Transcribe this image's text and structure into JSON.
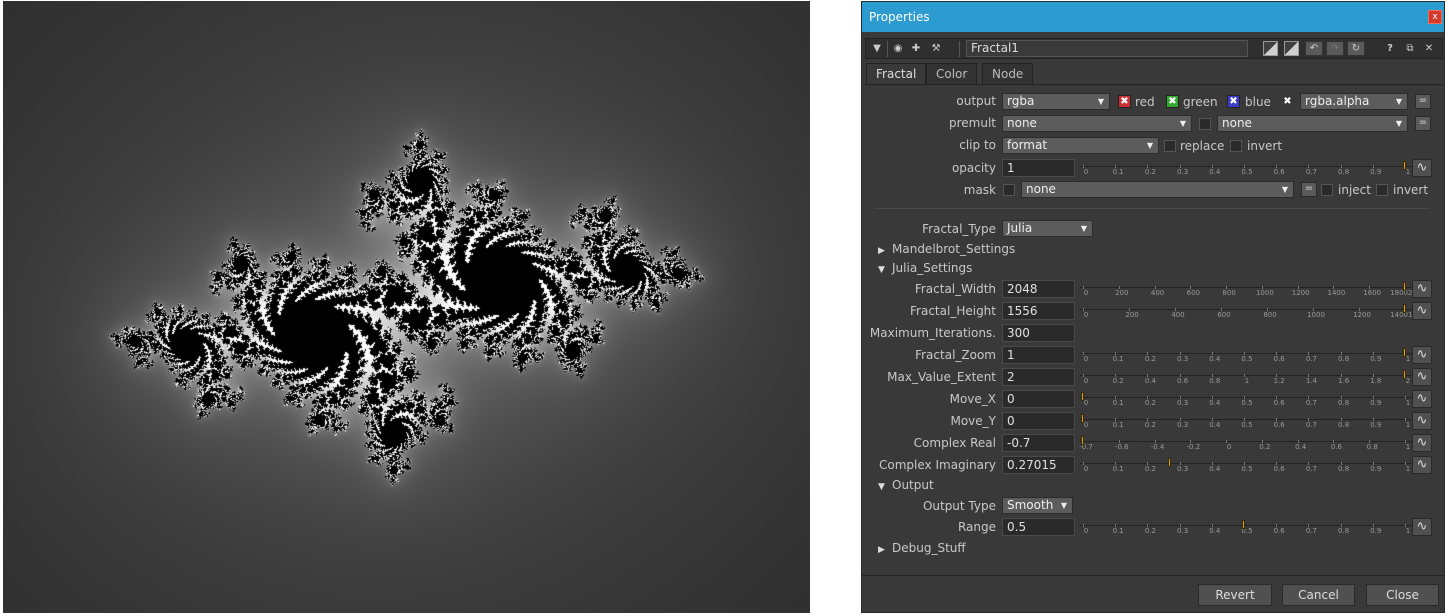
{
  "panel": {
    "title": "Properties",
    "close_label": "x"
  },
  "nodebar": {
    "node_name": "Fractal1",
    "help_label": "?"
  },
  "tabs": [
    "Fractal",
    "Color",
    "Node"
  ],
  "channels": {
    "output_label": "output",
    "output_value": "rgba",
    "red": "red",
    "green": "green",
    "blue": "blue",
    "alpha_value": "rgba.alpha",
    "premult_label": "premult",
    "premult_value": "none",
    "premult_value2": "none",
    "clip_label": "clip to",
    "clip_value": "format",
    "replace": "replace",
    "invert": "invert",
    "opacity_label": "opacity",
    "opacity_value": "1",
    "mask_label": "mask",
    "mask_value": "none",
    "inject": "inject",
    "mask_invert": "invert",
    "eq": "="
  },
  "fractal": {
    "type_label": "Fractal_Type",
    "type_value": "Julia",
    "mandelbrot_group": "Mandelbrot_Settings",
    "julia_group": "Julia_Settings",
    "output_group": "Output",
    "debug_group": "Debug_Stuff",
    "output_type_label": "Output Type",
    "output_type_value": "Smooth"
  },
  "knobs": [
    {
      "label": "Fractal_Width",
      "value": "2048",
      "ticks": [
        "0",
        "200",
        "400",
        "600",
        "800",
        "1000",
        "1200",
        "1400",
        "1600",
        "18002048"
      ],
      "level": 1.0
    },
    {
      "label": "Fractal_Height",
      "value": "1556",
      "ticks": [
        "0",
        "200",
        "400",
        "600",
        "800",
        "1000",
        "1200",
        "14001556"
      ],
      "level": 1.0
    },
    {
      "label": "Maximum_Iterations.",
      "value": "300"
    },
    {
      "label": "Fractal_Zoom",
      "value": "1",
      "ticks": [
        "0",
        "0.1",
        "0.2",
        "0.3",
        "0.4",
        "0.5",
        "0.6",
        "0.7",
        "0.8",
        "0.9",
        "1"
      ],
      "level": 1.0
    },
    {
      "label": "Max_Value_Extent",
      "value": "2",
      "ticks": [
        "0",
        "0.2",
        "0.4",
        "0.6",
        "0.8",
        "1",
        "1.2",
        "1.4",
        "1.6",
        "1.8",
        "2"
      ],
      "level": 1.0
    },
    {
      "label": "Move_X",
      "value": "0",
      "ticks": [
        "0",
        "0.1",
        "0.2",
        "0.3",
        "0.4",
        "0.5",
        "0.6",
        "0.7",
        "0.8",
        "0.9",
        "1"
      ],
      "level": 0.0
    },
    {
      "label": "Move_Y",
      "value": "0",
      "ticks": [
        "0",
        "0.1",
        "0.2",
        "0.3",
        "0.4",
        "0.5",
        "0.6",
        "0.7",
        "0.8",
        "0.9",
        "1"
      ],
      "level": 0.0
    },
    {
      "label": "Complex Real",
      "value": "-0.7",
      "ticks": [
        "-0.7",
        "-0.6",
        "-0.4",
        "-0.2",
        "0",
        "0.2",
        "0.4",
        "0.6",
        "0.8",
        "1"
      ],
      "level": 0.0
    },
    {
      "label": "Complex Imaginary",
      "value": "0.27015",
      "ticks": [
        "0",
        "0.1",
        "0.2",
        "0.3",
        "0.4",
        "0.5",
        "0.6",
        "0.7",
        "0.8",
        "0.9",
        "1"
      ],
      "level": 0.27
    }
  ],
  "range": {
    "label": "Range",
    "value": "0.5",
    "ticks": [
      "0",
      "0.1",
      "0.2",
      "0.3",
      "0.4",
      "0.5",
      "0.6",
      "0.7",
      "0.8",
      "0.9",
      "1"
    ],
    "level": 0.5
  },
  "opacity_ticks": [
    "0",
    "0.1",
    "0.2",
    "0.3",
    "0.4",
    "0.5",
    "0.6",
    "0.7",
    "0.8",
    "0.9",
    "1"
  ],
  "footer": {
    "revert": "Revert",
    "cancel": "Cancel",
    "close": "Close"
  },
  "colors": {
    "accent": "#2b9bd0",
    "handle": "#d9a030",
    "red_check": "#c83232",
    "green_check": "#32a832",
    "blue_check": "#3c3cc8"
  }
}
